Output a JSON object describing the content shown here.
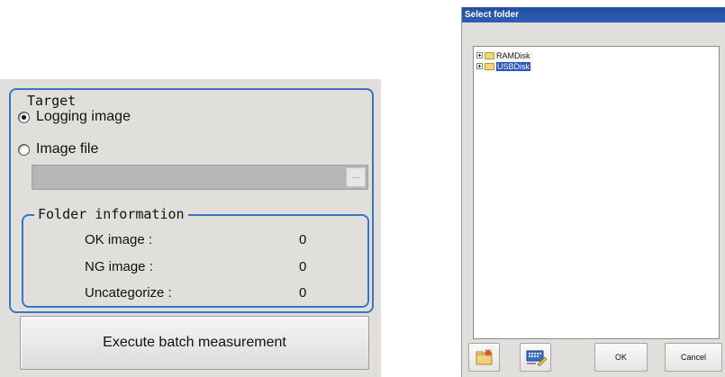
{
  "target_panel": {
    "group_title": "Target",
    "option_logging": "Logging image",
    "option_image_file": "Image file",
    "selected_option": "Logging image",
    "path_value": "",
    "browse_label": "...",
    "folder_info": {
      "title": "Folder information",
      "rows": [
        {
          "label": "OK image :",
          "value": "0"
        },
        {
          "label": "NG image :",
          "value": "0"
        },
        {
          "label": "Uncategorize :",
          "value": "0"
        }
      ]
    },
    "execute_label": "Execute batch measurement"
  },
  "select_folder_dialog": {
    "title": "Select folder",
    "tree": [
      {
        "label": "RAMDisk",
        "selected": false
      },
      {
        "label": "USBDisk",
        "selected": true
      }
    ],
    "ok_label": "OK",
    "cancel_label": "Cancel",
    "icons": [
      "new-folder-icon",
      "rename-icon"
    ]
  },
  "colors": {
    "panel_bg": "#e0dfdc",
    "group_border": "#3a74c4",
    "titlebar": "#2a55b0",
    "selection": "#2a55c0"
  }
}
